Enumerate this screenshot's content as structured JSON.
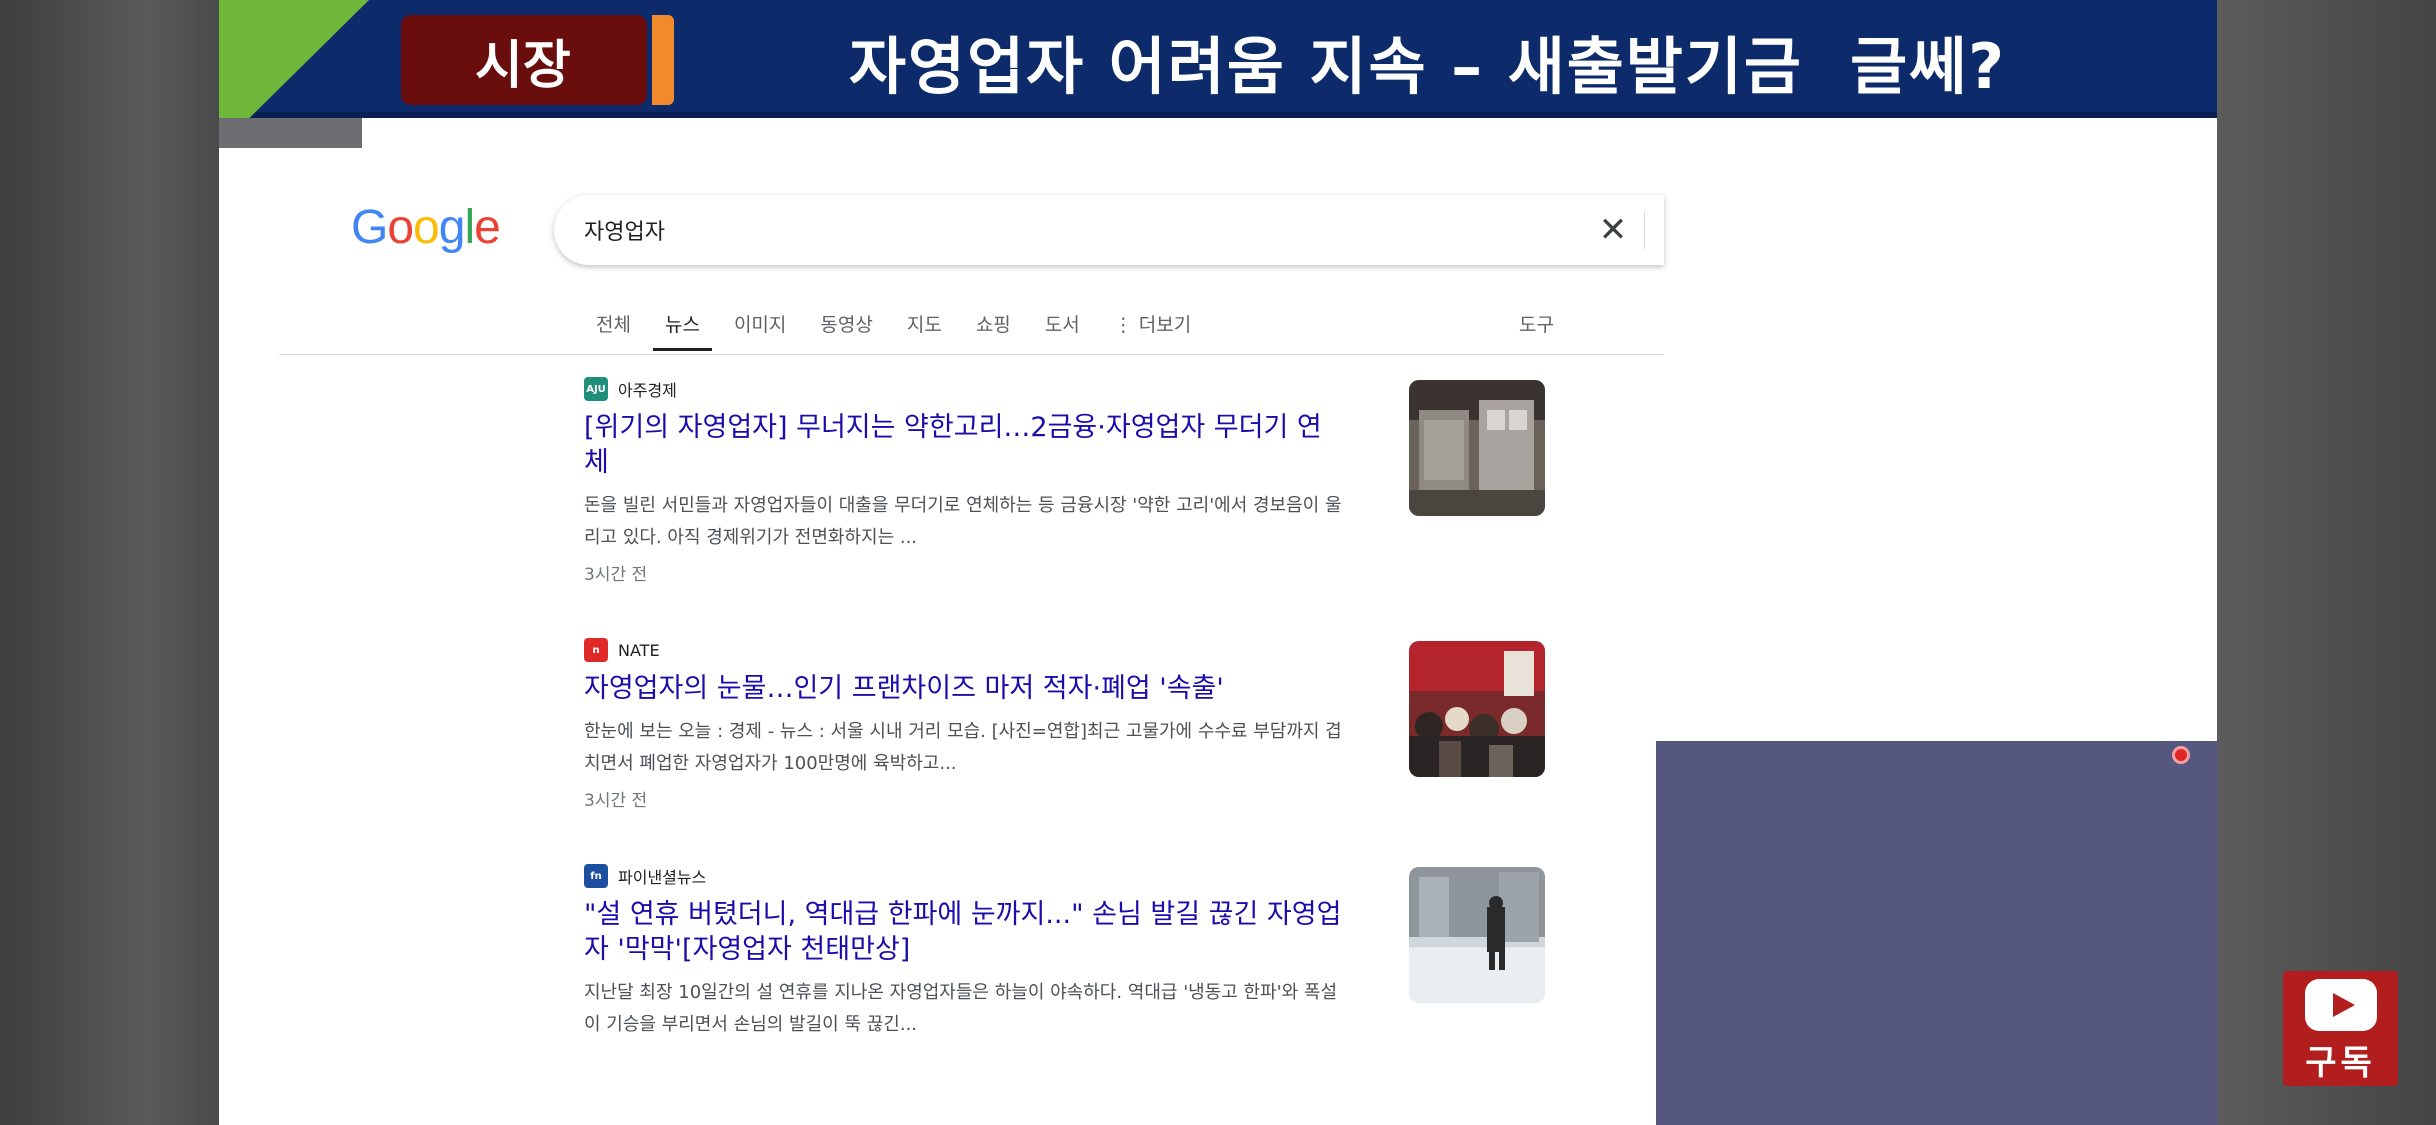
{
  "banner": {
    "tag": "시장",
    "headline": "자영업자 어려움 지속 – 새출발기금  글쎄?"
  },
  "google": {
    "logo": [
      "G",
      "o",
      "o",
      "g",
      "l",
      "e"
    ],
    "logo_colors": [
      "#4285f4",
      "#ea4335",
      "#fbbc05",
      "#4285f4",
      "#34a853",
      "#ea4335"
    ],
    "search_value": "자영업자",
    "clear_icon": "✕",
    "tabs": [
      {
        "label": "전체",
        "active": false
      },
      {
        "label": "뉴스",
        "active": true
      },
      {
        "label": "이미지",
        "active": false
      },
      {
        "label": "동영상",
        "active": false
      },
      {
        "label": "지도",
        "active": false
      },
      {
        "label": "쇼핑",
        "active": false
      },
      {
        "label": "도서",
        "active": false
      },
      {
        "label": "⋮ 더보기",
        "active": false
      }
    ],
    "tools": "도구"
  },
  "results": [
    {
      "source": "아주경제",
      "source_icon_color": "#1f8f7a",
      "source_icon_text": "AJU",
      "title": "[위기의 자영업자] 무너지는 약한고리…2금융·자영업자 무더기 연체",
      "snippet": "돈을 빌린 서민들과 자영업자들이 대출을 무더기로 연체하는 등 금융시장 '약한 고리'에서 경보음이 울리고 있다. 아직 경제위기가 전면화하지는 ...",
      "time": "3시간 전",
      "thumb": "store-interior-image"
    },
    {
      "source": "NATE",
      "source_icon_color": "#e02a2a",
      "source_icon_text": "n",
      "title": "자영업자의 눈물…인기 프랜차이즈 마저 적자·폐업 '속출'",
      "snippet": "한눈에 보는 오늘 : 경제 - 뉴스 : 서울 시내 거리 모습. [사진=연합]최근 고물가에 수수료 부담까지 겹치면서 폐업한 자영업자가 100만명에 육박하고...",
      "time": "3시간 전",
      "thumb": "street-crowd-image"
    },
    {
      "source": "파이낸셜뉴스",
      "source_icon_color": "#1d4fa0",
      "source_icon_text": "fn",
      "title": "\"설 연휴 버텼더니, 역대급 한파에 눈까지...\" 손님 발길 끊긴 자영업자 '막막'[자영업자 천태만상]",
      "snippet": "지난달 최장 10일간의 설 연휴를 지나온 자영업자들은 하늘이 야속하다. 역대급 '냉동고 한파'와 폭설이 기승을 부리면서 손님의 발길이 뚝 끊긴...",
      "time": "",
      "thumb": "snowy-street-image"
    }
  ],
  "subscribe": {
    "label": "구독",
    "icon": "youtube-play-icon"
  },
  "colors": {
    "banner": "#0d2a6b",
    "tag": "#6a0d0d",
    "tag_accent": "#f08a2c",
    "green": "#6fb83c",
    "link": "#1a0dab",
    "overlay": "#55577f",
    "subscribe": "#b21d1d"
  }
}
